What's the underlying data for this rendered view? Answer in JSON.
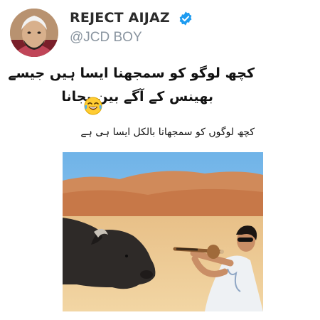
{
  "profile": {
    "display_name": "REJECT AIJAZ",
    "handle": "@JCD BOY",
    "verified_icon": "verified-badge-icon",
    "colors": {
      "verified": "#1d9bf0",
      "handle": "#8a95a0"
    }
  },
  "tweet": {
    "line1": "کچھ لوگو کو سمجھنا ایسا ہیں جیسے",
    "line2": "بھینس کے آگے بین بجانا",
    "emoji_icon": "laughing-tears-emoji-icon"
  },
  "image": {
    "caption": "کچھ لوگوں کو سمجھانا بالکل ایسا ہی ہے",
    "description_icon": "buffalo-and-snake-charmer-photo"
  }
}
